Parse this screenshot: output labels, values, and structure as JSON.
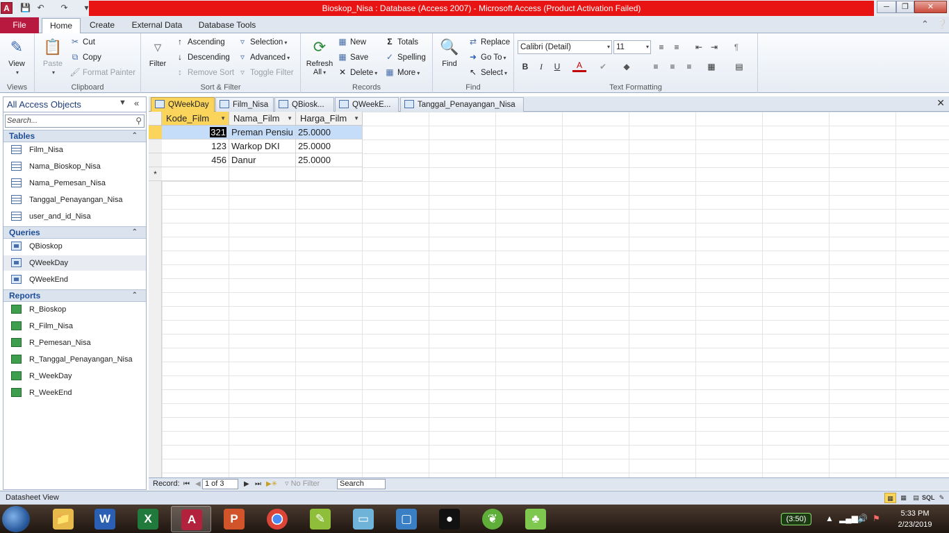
{
  "window": {
    "title": "Bioskop_Nisa : Database (Access 2007)  -  Microsoft Access (Product Activation Failed)",
    "app_icon": "A",
    "title_color": "#e81414"
  },
  "ribbon_tabs": {
    "file": "File",
    "home": "Home",
    "create": "Create",
    "external": "External Data",
    "dbtools": "Database Tools"
  },
  "ribbon": {
    "views": {
      "view": "View",
      "title": "Views"
    },
    "clipboard": {
      "paste": "Paste",
      "cut": "Cut",
      "copy": "Copy",
      "format_painter": "Format Painter",
      "title": "Clipboard"
    },
    "sort_filter": {
      "filter": "Filter",
      "ascending": "Ascending",
      "descending": "Descending",
      "remove_sort": "Remove Sort",
      "selection": "Selection",
      "advanced": "Advanced",
      "toggle_filter": "Toggle Filter",
      "title": "Sort & Filter"
    },
    "records": {
      "refresh": "Refresh",
      "refresh_all": "All",
      "new": "New",
      "save": "Save",
      "delete": "Delete",
      "totals": "Totals",
      "spelling": "Spelling",
      "more": "More",
      "title": "Records"
    },
    "find": {
      "find": "Find",
      "replace": "Replace",
      "goto": "Go To",
      "select": "Select",
      "title": "Find"
    },
    "text_formatting": {
      "font": "Calibri (Detail)",
      "size": "11",
      "bold": "B",
      "italic": "I",
      "underline": "U",
      "title": "Text Formatting"
    }
  },
  "nav": {
    "title": "All Access Objects",
    "search_placeholder": "Search...",
    "sections": {
      "tables": "Tables",
      "queries": "Queries",
      "reports": "Reports"
    },
    "tables": [
      "Film_Nisa",
      "Nama_Bioskop_Nisa",
      "Nama_Pemesan_Nisa",
      "Tanggal_Penayangan_Nisa",
      "user_and_id_Nisa"
    ],
    "queries": [
      "QBioskop",
      "QWeekDay",
      "QWeekEnd"
    ],
    "reports": [
      "R_Bioskop",
      "R_Film_Nisa",
      "R_Pemesan_Nisa",
      "R_Tanggal_Penayangan_Nisa",
      "R_WeekDay",
      "R_WeekEnd"
    ]
  },
  "doc_tabs": [
    "QWeekDay",
    "Film_Nisa",
    "QBiosk...",
    "QWeekE...",
    "Tanggal_Penayangan_Nisa"
  ],
  "datasheet": {
    "columns": [
      "Kode_Film",
      "Nama_Film",
      "Harga_Film"
    ],
    "rows": [
      [
        "321",
        "Preman Pensiu",
        "25.0000"
      ],
      [
        "123",
        "Warkop DKI",
        "25.0000"
      ],
      [
        "456",
        "Danur",
        "25.0000"
      ]
    ],
    "new_row_marker": "*"
  },
  "record_nav": {
    "label": "Record:",
    "current": "1 of 3",
    "filter": "No Filter",
    "search": "Search"
  },
  "status": {
    "text": "Datasheet View",
    "sql": "SQL"
  },
  "taskbar": {
    "battery": "(3:50)",
    "time": "5:33 PM",
    "date": "2/23/2019"
  }
}
